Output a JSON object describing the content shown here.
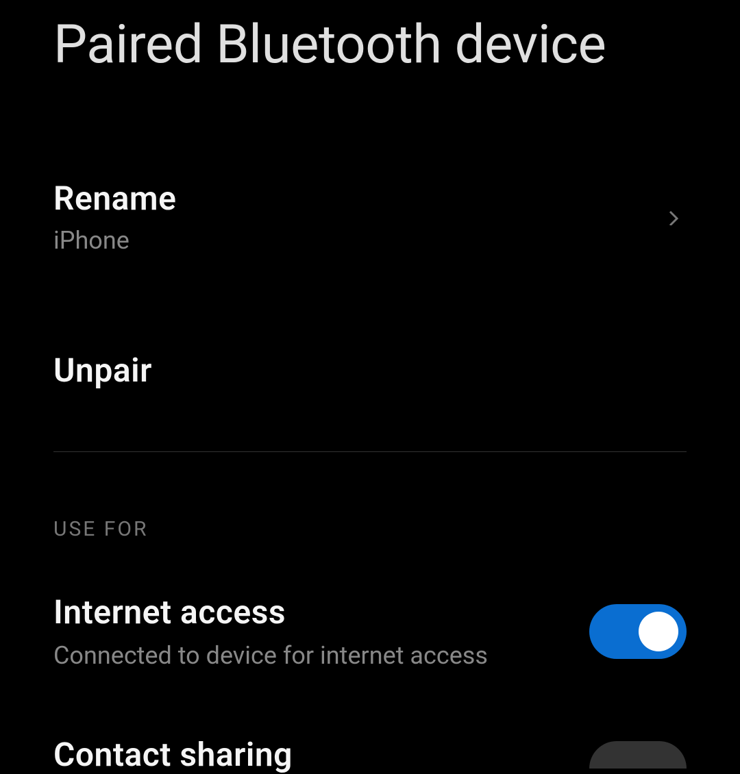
{
  "header": {
    "title": "Paired Bluetooth device"
  },
  "rename": {
    "label": "Rename",
    "value": "iPhone"
  },
  "unpair": {
    "label": "Unpair"
  },
  "section": {
    "header": "USE FOR"
  },
  "internet": {
    "label": "Internet access",
    "subtitle": "Connected to device for internet access",
    "enabled": true
  },
  "contact": {
    "label": "Contact sharing"
  }
}
